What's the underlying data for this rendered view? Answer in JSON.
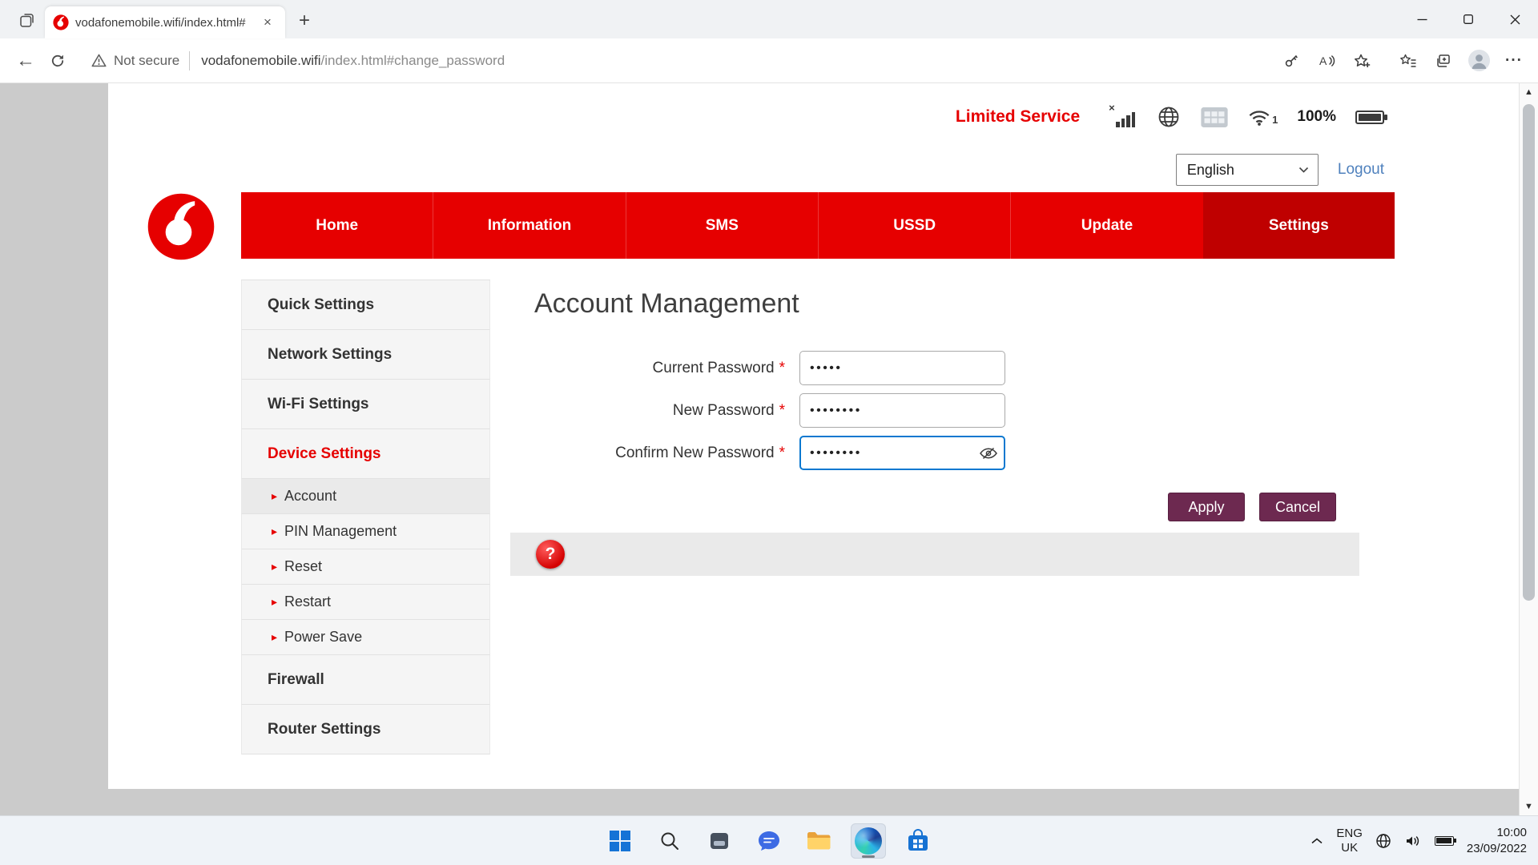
{
  "browser": {
    "tab_title": "vodafonemobile.wifi/index.html#",
    "security_label": "Not secure",
    "url_host": "vodafonemobile.wifi",
    "url_path": "/index.html#change_password"
  },
  "icons": {
    "close": "×",
    "new_tab": "+",
    "back": "←",
    "more": "···",
    "scroll_up": "▲",
    "scroll_down": "▼",
    "arrow": "▸",
    "x_mark": "×",
    "asterisk": "*"
  },
  "page": {
    "status": {
      "limited_service": "Limited Service",
      "wifi_badge": "1",
      "battery_percent": "100%"
    },
    "language_selected": "English",
    "logout_label": "Logout",
    "nav": {
      "items": [
        {
          "label": "Home"
        },
        {
          "label": "Information"
        },
        {
          "label": "SMS"
        },
        {
          "label": "USSD"
        },
        {
          "label": "Update"
        },
        {
          "label": "Settings"
        }
      ]
    },
    "sidebar": {
      "items": [
        {
          "label": "Quick Settings"
        },
        {
          "label": "Network Settings"
        },
        {
          "label": "Wi-Fi Settings"
        },
        {
          "label": "Device Settings"
        },
        {
          "label": "Account"
        },
        {
          "label": "PIN Management"
        },
        {
          "label": "Reset"
        },
        {
          "label": "Restart"
        },
        {
          "label": "Power Save"
        },
        {
          "label": "Firewall"
        },
        {
          "label": "Router Settings"
        }
      ]
    },
    "main": {
      "title": "Account Management",
      "fields": [
        {
          "label": "Current Password",
          "value": "•••••"
        },
        {
          "label": "New Password",
          "value": "••••••••"
        },
        {
          "label": "Confirm New Password",
          "value": "••••••••"
        }
      ],
      "apply_label": "Apply",
      "cancel_label": "Cancel",
      "help_label": "?"
    }
  },
  "taskbar": {
    "language_line1": "ENG",
    "language_line2": "UK",
    "time": "10:00",
    "date": "23/09/2022"
  },
  "colors": {
    "vodafone_red": "#e60000",
    "nav_active_red": "#bf0000",
    "button_berry": "#6d2950",
    "focus_blue": "#0b78d0",
    "link_blue": "#4f81bd"
  }
}
